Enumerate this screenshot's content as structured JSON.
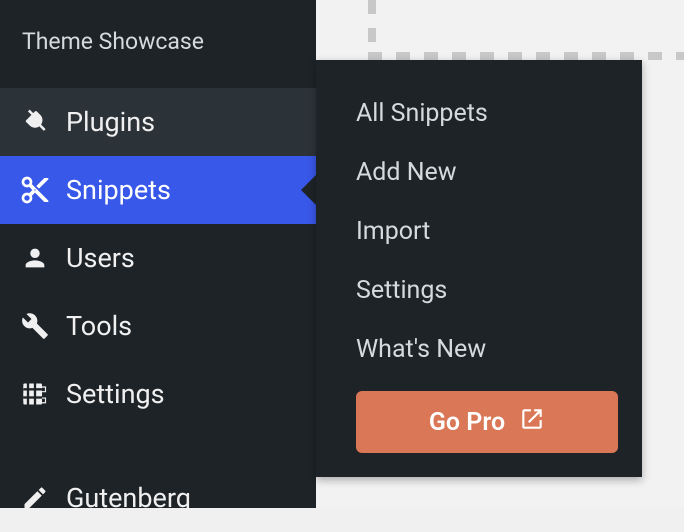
{
  "sidebar": {
    "top_label": "Theme Showcase",
    "items": [
      {
        "label": "Plugins"
      },
      {
        "label": "Snippets"
      },
      {
        "label": "Users"
      },
      {
        "label": "Tools"
      },
      {
        "label": "Settings"
      },
      {
        "label": "Gutenberg"
      }
    ]
  },
  "flyout": {
    "items": [
      {
        "label": "All Snippets"
      },
      {
        "label": "Add New"
      },
      {
        "label": "Import"
      },
      {
        "label": "Settings"
      },
      {
        "label": "What's New"
      }
    ],
    "go_pro_label": "Go Pro"
  }
}
